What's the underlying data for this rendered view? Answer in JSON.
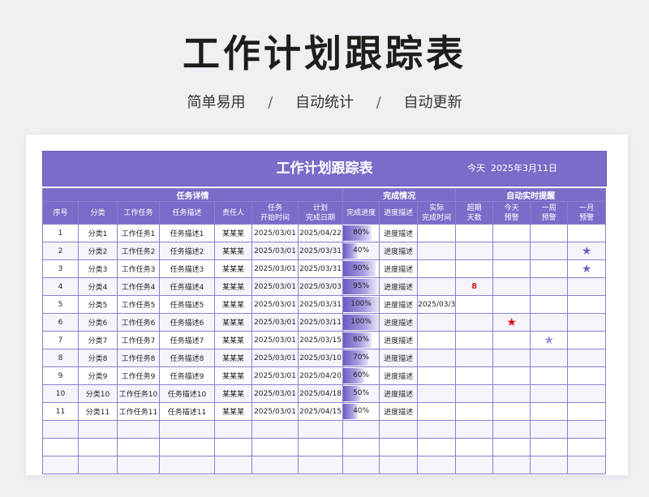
{
  "page": {
    "title": "工作计划跟踪表",
    "taglines": [
      "简单易用",
      "自动统计",
      "自动更新"
    ],
    "separator": "/"
  },
  "sheet": {
    "title": "工作计划跟踪表",
    "today_label": "今天",
    "today_date": "2025年3月11日"
  },
  "groups": [
    "任务详情",
    "完成情况",
    "自动实时提醒"
  ],
  "columns": [
    "序号",
    "分类",
    "工作任务",
    "任务描述",
    "责任人",
    "任务\n开始时间",
    "计划\n完成日期",
    "完成进度",
    "进度描述",
    "实际\n完成时间",
    "超期\n天数",
    "今天\n预警",
    "一周\n预警",
    "一月\n预警"
  ],
  "rows": [
    {
      "no": "1",
      "cat": "分类1",
      "task": "工作任务1",
      "desc": "任务描述1",
      "owner": "某某某",
      "start": "2025/03/01",
      "plan": "2025/04/22",
      "progress": "80%",
      "pdesc": "进度描述",
      "actual": "",
      "overdue": "",
      "alert": ""
    },
    {
      "no": "2",
      "cat": "分类2",
      "task": "工作任务2",
      "desc": "任务描述2",
      "owner": "某某某",
      "start": "2025/03/01",
      "plan": "2025/03/31",
      "progress": "40%",
      "pdesc": "进度描述",
      "actual": "",
      "overdue": "",
      "alert": "month"
    },
    {
      "no": "3",
      "cat": "分类3",
      "task": "工作任务3",
      "desc": "任务描述3",
      "owner": "某某某",
      "start": "2025/03/01",
      "plan": "2025/03/31",
      "progress": "90%",
      "pdesc": "进度描述",
      "actual": "",
      "overdue": "",
      "alert": "month"
    },
    {
      "no": "4",
      "cat": "分类4",
      "task": "工作任务4",
      "desc": "任务描述4",
      "owner": "某某某",
      "start": "2025/03/01",
      "plan": "2025/03/03",
      "progress": "95%",
      "pdesc": "进度描述",
      "actual": "",
      "overdue": "8",
      "alert": ""
    },
    {
      "no": "5",
      "cat": "分类5",
      "task": "工作任务5",
      "desc": "任务描述5",
      "owner": "某某某",
      "start": "2025/03/01",
      "plan": "2025/03/31",
      "progress": "100%",
      "pdesc": "进度描述",
      "actual": "2025/03/31",
      "overdue": "",
      "alert": ""
    },
    {
      "no": "6",
      "cat": "分类6",
      "task": "工作任务6",
      "desc": "任务描述6",
      "owner": "某某某",
      "start": "2025/03/01",
      "plan": "2025/03/11",
      "progress": "100%",
      "pdesc": "进度描述",
      "actual": "",
      "overdue": "",
      "alert": "today"
    },
    {
      "no": "7",
      "cat": "分类7",
      "task": "工作任务7",
      "desc": "任务描述7",
      "owner": "某某某",
      "start": "2025/03/01",
      "plan": "2025/03/15",
      "progress": "80%",
      "pdesc": "进度描述",
      "actual": "",
      "overdue": "",
      "alert": "week"
    },
    {
      "no": "8",
      "cat": "分类8",
      "task": "工作任务8",
      "desc": "任务描述8",
      "owner": "某某某",
      "start": "2025/03/01",
      "plan": "2025/03/10",
      "progress": "70%",
      "pdesc": "进度描述",
      "actual": "",
      "overdue": "",
      "alert": ""
    },
    {
      "no": "9",
      "cat": "分类9",
      "task": "工作任务9",
      "desc": "任务描述9",
      "owner": "某某某",
      "start": "2025/03/01",
      "plan": "2025/04/20",
      "progress": "60%",
      "pdesc": "进度描述",
      "actual": "",
      "overdue": "",
      "alert": ""
    },
    {
      "no": "10",
      "cat": "分类10",
      "task": "工作任务10",
      "desc": "任务描述10",
      "owner": "某某某",
      "start": "2025/03/01",
      "plan": "2025/04/18",
      "progress": "50%",
      "pdesc": "进度描述",
      "actual": "",
      "overdue": "",
      "alert": ""
    },
    {
      "no": "11",
      "cat": "分类11",
      "task": "工作任务11",
      "desc": "任务描述11",
      "owner": "某某某",
      "start": "2025/03/01",
      "plan": "2025/04/15",
      "progress": "40%",
      "pdesc": "进度描述",
      "actual": "",
      "overdue": "",
      "alert": ""
    }
  ],
  "empty_rows": 3,
  "star_glyph": "★",
  "colors": {
    "accent": "#7b6cc9",
    "today_star": "#d9101a",
    "month_star": "#7263c4",
    "week_star": "#9b90d8",
    "overdue": "#d0201b"
  }
}
